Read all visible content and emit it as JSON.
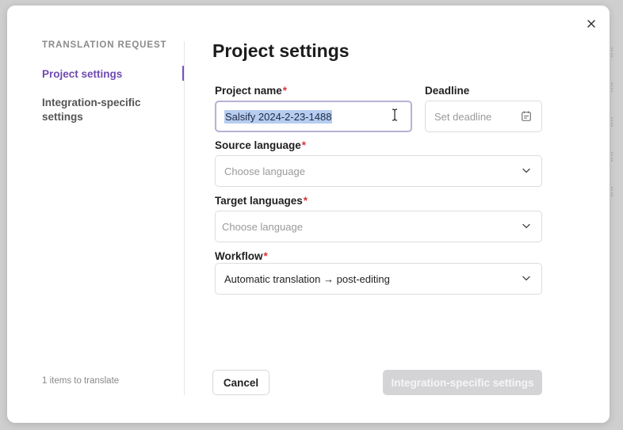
{
  "sidebar": {
    "heading": "TRANSLATION REQUEST",
    "items": [
      {
        "label": "Project settings",
        "active": true
      },
      {
        "label": "Integration-specific settings",
        "active": false
      }
    ],
    "items_count": "1 items to translate"
  },
  "main": {
    "title": "Project settings",
    "project_name": {
      "label": "Project name",
      "required_mark": "*",
      "value": "Salsify 2024-2-23-1488"
    },
    "deadline": {
      "label": "Deadline",
      "placeholder": "Set deadline"
    },
    "source_language": {
      "label": "Source language",
      "required_mark": "*",
      "placeholder": "Choose language"
    },
    "target_languages": {
      "label": "Target languages",
      "required_mark": "*",
      "placeholder": "Choose language"
    },
    "workflow": {
      "label": "Workflow",
      "required_mark": "*",
      "value": "Automatic translation → post-editing"
    }
  },
  "footer": {
    "cancel_label": "Cancel",
    "next_label": "Integration-specific settings"
  },
  "icons": {
    "close": "close-icon",
    "calendar": "calendar-icon",
    "chevron": "chevron-down-icon",
    "cursor": "text-cursor-icon"
  },
  "colors": {
    "accent": "#6e4bb0",
    "required": "#d8343c",
    "selection": "#b7cdf0",
    "disabled_button": "#d4d4d6"
  }
}
